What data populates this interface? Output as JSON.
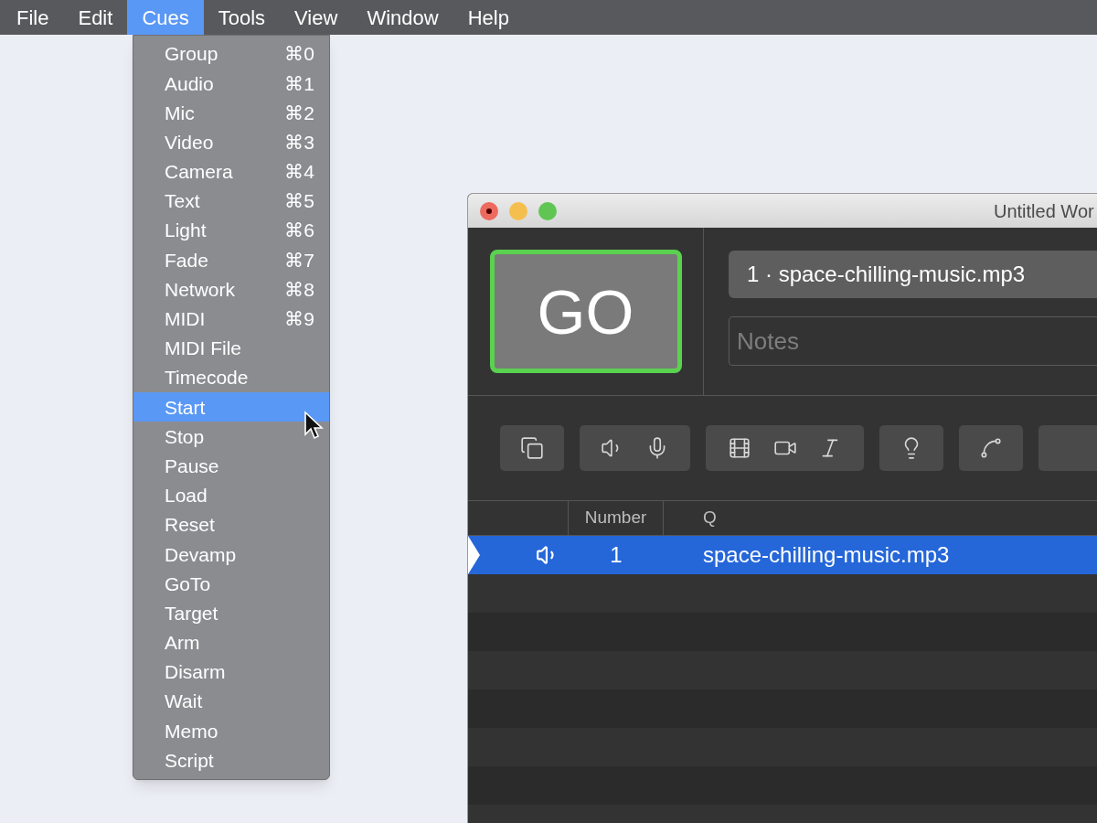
{
  "menu_bar": [
    {
      "label": "File",
      "selected": false
    },
    {
      "label": "Edit",
      "selected": false
    },
    {
      "label": "Cues",
      "selected": true
    },
    {
      "label": "Tools",
      "selected": false
    },
    {
      "label": "View",
      "selected": false
    },
    {
      "label": "Window",
      "selected": false
    },
    {
      "label": "Help",
      "selected": false
    }
  ],
  "menu": {
    "items": [
      {
        "label": "Group",
        "shortcut": "⌘0",
        "selected": false
      },
      {
        "label": "Audio",
        "shortcut": "⌘1",
        "selected": false
      },
      {
        "label": "Mic",
        "shortcut": "⌘2",
        "selected": false
      },
      {
        "label": "Video",
        "shortcut": "⌘3",
        "selected": false
      },
      {
        "label": "Camera",
        "shortcut": "⌘4",
        "selected": false
      },
      {
        "label": "Text",
        "shortcut": "⌘5",
        "selected": false
      },
      {
        "label": "Light",
        "shortcut": "⌘6",
        "selected": false
      },
      {
        "label": "Fade",
        "shortcut": "⌘7",
        "selected": false
      },
      {
        "label": "Network",
        "shortcut": "⌘8",
        "selected": false
      },
      {
        "label": "MIDI",
        "shortcut": "⌘9",
        "selected": false
      },
      {
        "label": "MIDI File",
        "selected": false
      },
      {
        "label": "Timecode",
        "selected": false
      },
      {
        "label": "Start",
        "selected": true
      },
      {
        "label": "Stop",
        "selected": false
      },
      {
        "label": "Pause",
        "selected": false
      },
      {
        "label": "Load",
        "selected": false
      },
      {
        "label": "Reset",
        "selected": false
      },
      {
        "label": "Devamp",
        "selected": false
      },
      {
        "label": "GoTo",
        "selected": false
      },
      {
        "label": "Target",
        "selected": false
      },
      {
        "label": "Arm",
        "selected": false
      },
      {
        "label": "Disarm",
        "selected": false
      },
      {
        "label": "Wait",
        "selected": false
      },
      {
        "label": "Memo",
        "selected": false
      },
      {
        "label": "Script",
        "selected": false
      }
    ]
  },
  "window": {
    "title": "Untitled Wor",
    "go_button": "GO",
    "cue_name": "1 · space-chilling-music.mp3",
    "notes": {
      "placeholder": "Notes"
    },
    "table": {
      "columns": [
        "Number",
        "Q"
      ],
      "rows": [
        {
          "selected": true,
          "playhead": true,
          "number": "1",
          "q": "space-chilling-music.mp3"
        }
      ]
    }
  }
}
